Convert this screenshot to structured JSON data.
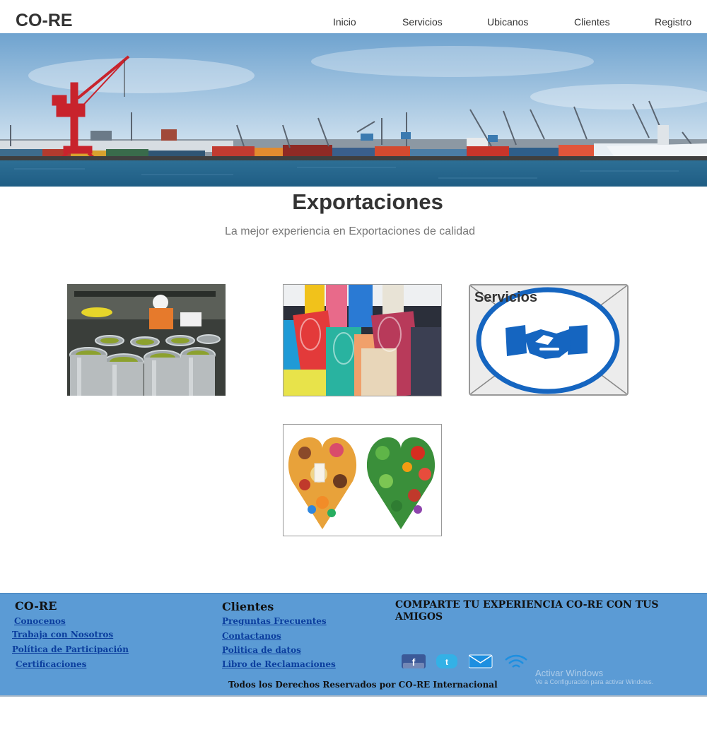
{
  "header": {
    "brand": "CO-RE",
    "nav": [
      "Inicio",
      "Servicios",
      "Ubicanos",
      "Clientes",
      "Registro"
    ]
  },
  "hero": {
    "title": "Exportaciones",
    "subtitle": "La mejor experiencia en Exportaciones de calidad"
  },
  "cards": {
    "services_label": "Servicios"
  },
  "footer": {
    "col1": {
      "title": "CO-RE",
      "links": [
        "Conocenos",
        "Trabaja con Nosotros",
        "Política de Participación",
        "Certificaciones"
      ]
    },
    "col2": {
      "title": "Clientes",
      "links": [
        "Preguntas Frecuentes",
        "Contactanos",
        "Politica de datos",
        "Libro de Reclamaciones"
      ]
    },
    "share": "COMPARTE TU EXPERIENCIA CO-RE CON TUS AMIGOS",
    "social_icons": [
      "facebook-icon",
      "twitter-icon",
      "email-icon",
      "wifi-icon"
    ],
    "copyright": "Todos los Derechos Reservados por CO-RE Internacional",
    "watermark": {
      "line1": "Activar Windows",
      "line2": "Ve a Configuración para activar Windows."
    }
  },
  "colors": {
    "footer_bg": "#5b9bd5",
    "link_color": "#0b3e9e",
    "handshake_blue": "#1565c0"
  }
}
